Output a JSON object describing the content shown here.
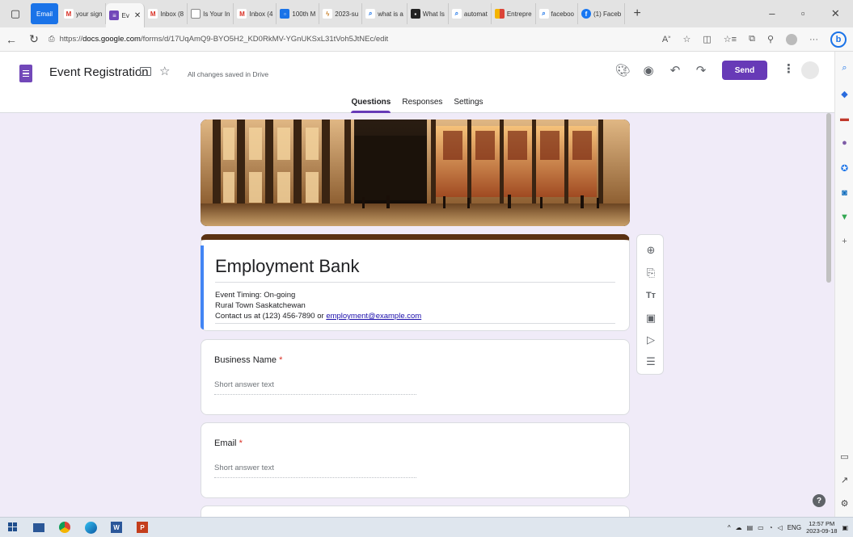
{
  "browser": {
    "tabs": [
      {
        "label": "Email",
        "kind": "email"
      },
      {
        "label": "your sign",
        "favicon": "gmail-icon"
      },
      {
        "label": "Ev",
        "favicon": "forms-icon",
        "active": true
      },
      {
        "label": "Inbox (8",
        "favicon": "gmail-icon"
      },
      {
        "label": "Is Your In",
        "favicon": "doc-icon"
      },
      {
        "label": "Inbox (4",
        "favicon": "gmail-icon"
      },
      {
        "label": "100th M",
        "favicon": "calendar-icon"
      },
      {
        "label": "2023-su",
        "favicon": "lightning-icon"
      },
      {
        "label": "what is a",
        "favicon": "search-icon"
      },
      {
        "label": "What Is",
        "favicon": "doc-icon"
      },
      {
        "label": "automat",
        "favicon": "search-icon"
      },
      {
        "label": "Entrepre",
        "favicon": "grid-icon"
      },
      {
        "label": "faceboo",
        "favicon": "search-icon"
      },
      {
        "label": "(1) Faceb",
        "favicon": "facebook-icon"
      }
    ],
    "new_tab_label": "+",
    "url": {
      "prefix": "https://",
      "host": "docs.google.com",
      "path": "/forms/d/17UqAmQ9-BYO5H2_KD0RkMV-YGnUKSxL31tVoh5JtNEc/edit"
    },
    "bing_label": "b"
  },
  "forms_header": {
    "form_name": "Event Registration",
    "save_status": "All changes saved in Drive",
    "send_label": "Send",
    "tabs": [
      "Questions",
      "Responses",
      "Settings"
    ],
    "active_tab": "Questions"
  },
  "form": {
    "title": "Employment Bank",
    "description_lines": [
      "Event Timing: On-going",
      "Rural Town Saskatchewan"
    ],
    "contact_prefix": "Contact us at (123) 456-7890 or ",
    "contact_email": "employment@example.com",
    "questions": [
      {
        "label": "Business Name",
        "required_mark": "*",
        "placeholder": "Short answer text"
      },
      {
        "label": "Email",
        "required_mark": "*",
        "placeholder": "Short answer text"
      }
    ]
  },
  "taskbar": {
    "tray_lang": "ENG",
    "time": "12:57 PM",
    "date": "2023-09-18"
  },
  "colors": {
    "primary": "#673ab7",
    "header_stripe": "#5a3112",
    "accent_blue": "#4285f4",
    "required": "#d93025"
  }
}
